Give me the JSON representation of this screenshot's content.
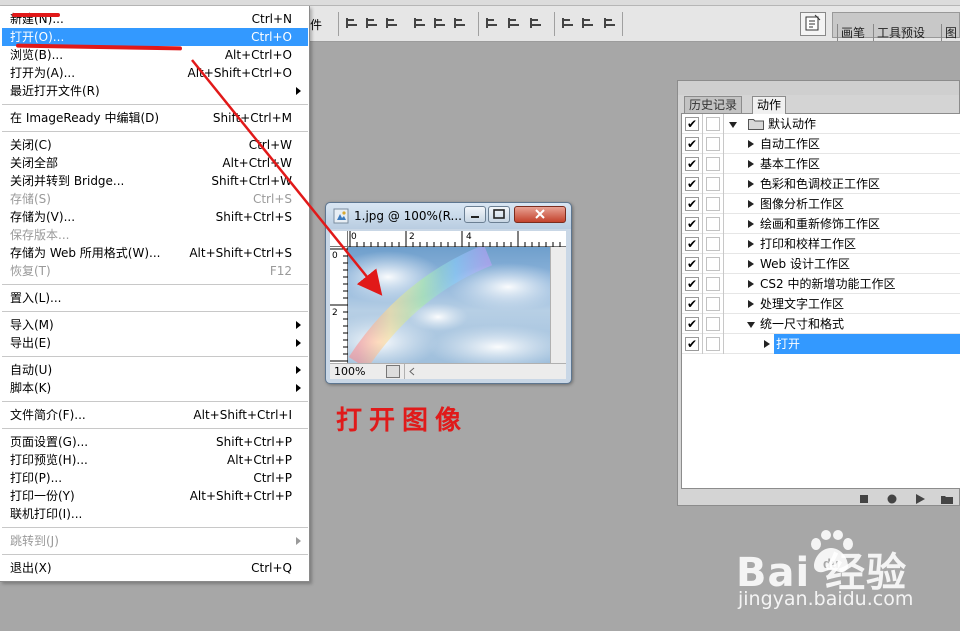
{
  "toolbar": {
    "partial_label": "件",
    "tabs": [
      "画笔",
      "工具预设",
      "图"
    ]
  },
  "file_menu": {
    "items": [
      {
        "label": "新建(N)...",
        "shortcut": "Ctrl+N"
      },
      {
        "label": "打开(O)...",
        "shortcut": "Ctrl+O",
        "selected": true
      },
      {
        "label": "浏览(B)...",
        "shortcut": "Alt+Ctrl+O"
      },
      {
        "label": "打开为(A)...",
        "shortcut": "Alt+Shift+Ctrl+O"
      },
      {
        "label": "最近打开文件(R)",
        "shortcut": "",
        "submenu": true
      },
      {
        "label": "在 ImageReady 中编辑(D)",
        "shortcut": "Shift+Ctrl+M"
      },
      {
        "label": "关闭(C)",
        "shortcut": "Ctrl+W"
      },
      {
        "label": "关闭全部",
        "shortcut": "Alt+Ctrl+W"
      },
      {
        "label": "关闭并转到 Bridge...",
        "shortcut": "Shift+Ctrl+W"
      },
      {
        "label": "存储(S)",
        "shortcut": "Ctrl+S",
        "disabled": true
      },
      {
        "label": "存储为(V)...",
        "shortcut": "Shift+Ctrl+S"
      },
      {
        "label": "保存版本...",
        "shortcut": "",
        "disabled": true
      },
      {
        "label": "存储为 Web 所用格式(W)...",
        "shortcut": "Alt+Shift+Ctrl+S"
      },
      {
        "label": "恢复(T)",
        "shortcut": "F12",
        "disabled": true
      },
      {
        "label": "置入(L)...",
        "shortcut": ""
      },
      {
        "label": "导入(M)",
        "shortcut": "",
        "submenu": true
      },
      {
        "label": "导出(E)",
        "shortcut": "",
        "submenu": true
      },
      {
        "label": "自动(U)",
        "shortcut": "",
        "submenu": true
      },
      {
        "label": "脚本(K)",
        "shortcut": "",
        "submenu": true
      },
      {
        "label": "文件简介(F)...",
        "shortcut": "Alt+Shift+Ctrl+I"
      },
      {
        "label": "页面设置(G)...",
        "shortcut": "Shift+Ctrl+P"
      },
      {
        "label": "打印预览(H)...",
        "shortcut": "Alt+Ctrl+P"
      },
      {
        "label": "打印(P)...",
        "shortcut": "Ctrl+P"
      },
      {
        "label": "打印一份(Y)",
        "shortcut": "Alt+Shift+Ctrl+P"
      },
      {
        "label": "联机打印(I)...",
        "shortcut": ""
      },
      {
        "label": "跳转到(J)",
        "shortcut": "",
        "submenu": true,
        "disabled": true
      },
      {
        "label": "退出(X)",
        "shortcut": "Ctrl+Q"
      }
    ]
  },
  "document_window": {
    "title": "1.jpg @ 100%(R...",
    "zoom": "100%",
    "ruler_h": [
      "0",
      "2",
      "4"
    ],
    "ruler_v": [
      "0",
      "2"
    ]
  },
  "caption": "打开图像",
  "actions_panel": {
    "tabs": [
      "历史记录",
      "动作"
    ],
    "active_tab": "动作",
    "rows": [
      {
        "label": "默认动作",
        "level": 0,
        "type": "set",
        "expanded": true
      },
      {
        "label": "自动工作区",
        "level": 1
      },
      {
        "label": "基本工作区",
        "level": 1
      },
      {
        "label": "色彩和色调校正工作区",
        "level": 1
      },
      {
        "label": "图像分析工作区",
        "level": 1
      },
      {
        "label": "绘画和重新修饰工作区",
        "level": 1
      },
      {
        "label": "打印和校样工作区",
        "level": 1
      },
      {
        "label": "Web 设计工作区",
        "level": 1
      },
      {
        "label": "CS2 中的新增功能工作区",
        "level": 1
      },
      {
        "label": "处理文字工作区",
        "level": 1
      },
      {
        "label": "统一尺寸和格式",
        "level": 1,
        "expanded": true
      },
      {
        "label": "打开",
        "level": 2,
        "selected": true
      }
    ]
  },
  "watermark": {
    "logo": "Bai  经验",
    "logo_du": "du",
    "url": "jingyan.baidu.com"
  },
  "colors": {
    "highlight": "#3399ff",
    "annotation_red": "#e11919",
    "workspace_gray": "#a7a7a7"
  }
}
